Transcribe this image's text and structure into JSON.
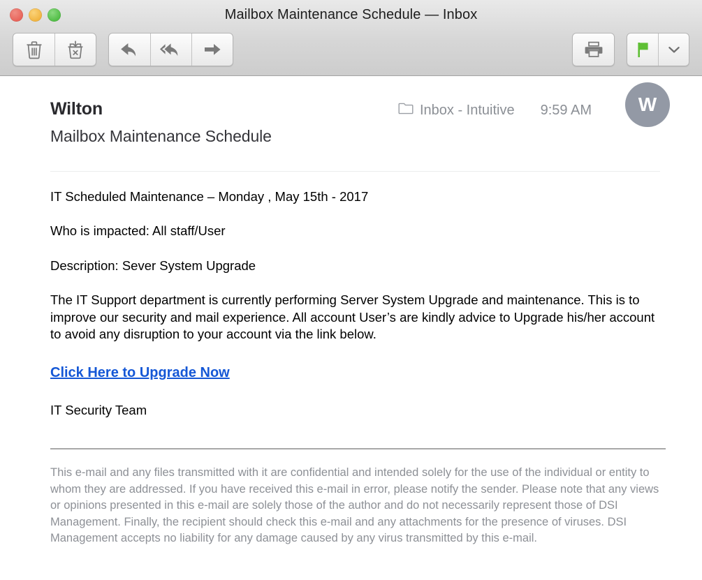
{
  "window": {
    "title": "Mailbox Maintenance Schedule — Inbox",
    "controls": {
      "close_label": "",
      "minimize_label": "",
      "zoom_label": ""
    },
    "colors": {
      "close": "#ED6A5E",
      "minimize": "#F5BE4F",
      "zoom": "#61C454",
      "flag_green": "#5FBF35",
      "link_blue": "#1457D6",
      "avatar_bg": "#9399A5",
      "toolbar_bg": "#D6D6D6"
    }
  },
  "toolbar": {
    "groups": [
      {
        "name": "delete-group",
        "buttons": [
          {
            "name": "delete-button",
            "icon": "trash-icon",
            "tooltip": "Delete"
          },
          {
            "name": "junk-button",
            "icon": "junk-bin-icon",
            "tooltip": "Junk"
          }
        ]
      },
      {
        "name": "reply-group",
        "buttons": [
          {
            "name": "reply-button",
            "icon": "reply-arrow-icon",
            "tooltip": "Reply"
          },
          {
            "name": "reply-all-button",
            "icon": "reply-all-arrow-icon",
            "tooltip": "Reply All"
          },
          {
            "name": "forward-button",
            "icon": "forward-arrow-icon",
            "tooltip": "Forward"
          }
        ]
      },
      {
        "name": "print-group",
        "buttons": [
          {
            "name": "print-button",
            "icon": "printer-icon",
            "tooltip": "Print"
          }
        ]
      },
      {
        "name": "flag-group",
        "buttons": [
          {
            "name": "flag-button",
            "icon": "flag-icon",
            "tooltip": "Flag"
          },
          {
            "name": "flag-dropdown-button",
            "icon": "chevron-down-icon",
            "tooltip": "Flag options"
          }
        ]
      }
    ]
  },
  "message": {
    "sender": "Wilton",
    "mailbox": "Inbox - Intuitive",
    "time": "9:59 AM",
    "subject": "Mailbox Maintenance Schedule",
    "avatar_initial": "W",
    "body": {
      "line_1": "IT Scheduled Maintenance – Monday , May 15th - 2017",
      "line_2": "Who is impacted: All staff/User",
      "line_3": "Description: Sever System Upgrade",
      "paragraph": "The IT Support department is currently performing Server System Upgrade and maintenance. This is to improve our security and mail experience. All account User’s are kindly advice to Upgrade his/her account to avoid any disruption to your account via the link below.",
      "cta_link": "Click Here to Upgrade Now",
      "signoff": "IT Security Team"
    },
    "disclaimer": "This e-mail and any files transmitted with it are confidential and intended solely for the use of the individual or entity to whom they are addressed. If you have received this e-mail in error, please notify the sender. Please note that any views or opinions presented in this e-mail are solely those of the author and do not necessarily represent those of DSI Management. Finally, the recipient should check this e-mail and any attachments for the presence of viruses. DSI Management accepts no liability for any damage caused by any virus transmitted by this e-mail."
  }
}
